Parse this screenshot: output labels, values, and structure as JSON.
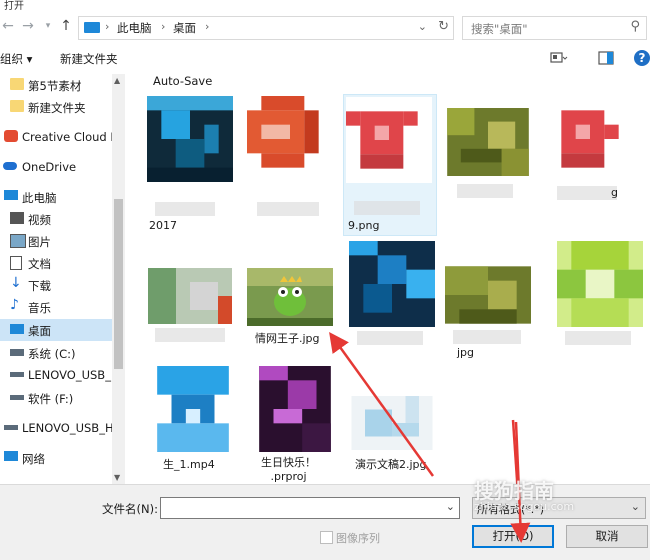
{
  "window": {
    "title": "打开"
  },
  "address": {
    "crumbs": [
      "此电脑",
      "桌面"
    ]
  },
  "search": {
    "placeholder": "搜索\"桌面\""
  },
  "toolbar": {
    "organize": "组织 ▾",
    "new_folder": "新建文件夹",
    "help": "?"
  },
  "sidebar": {
    "items": [
      {
        "label": "第5节素材",
        "icon": "folder-icon"
      },
      {
        "label": "新建文件夹",
        "icon": "folder-icon"
      },
      {
        "label": "Creative Cloud F",
        "icon": "creative-cloud-icon"
      },
      {
        "label": "OneDrive",
        "icon": "cloud-icon"
      },
      {
        "label": "此电脑",
        "icon": "computer-icon"
      },
      {
        "label": "视频",
        "icon": "video-icon"
      },
      {
        "label": "图片",
        "icon": "picture-icon"
      },
      {
        "label": "文档",
        "icon": "document-icon"
      },
      {
        "label": "下载",
        "icon": "download-icon"
      },
      {
        "label": "音乐",
        "icon": "music-icon"
      },
      {
        "label": "桌面",
        "icon": "desktop-icon",
        "selected": true
      },
      {
        "label": "系统 (C:)",
        "icon": "drive-icon"
      },
      {
        "label": "LENOVO_USB_",
        "icon": "drive-icon"
      },
      {
        "label": "软件 (F:)",
        "icon": "drive-icon"
      },
      {
        "label": "LENOVO_USB_H",
        "icon": "drive-icon"
      },
      {
        "label": "网络",
        "icon": "network-icon"
      }
    ]
  },
  "content": {
    "group_header": "Auto-Save",
    "files": [
      {
        "label": "2017"
      },
      {
        "label": ""
      },
      {
        "label": "9.png"
      },
      {
        "label": ""
      },
      {
        "label": "g"
      },
      {
        "label": ""
      },
      {
        "label": "情网王子.jpg"
      },
      {
        "label": ""
      },
      {
        "label": "jpg"
      },
      {
        "label": ""
      },
      {
        "label": "生_1.mp4"
      },
      {
        "label": "生日快乐！\n.prproj"
      },
      {
        "label": "演示文稿2.jpg"
      }
    ]
  },
  "bottom": {
    "filename_label": "文件名(N):",
    "filename_value": "",
    "filetype_value": "所有格式(*.*)",
    "image_sequence_label": "图像序列",
    "open_button": "打开(O)",
    "cancel_button": "取消"
  },
  "watermark": {
    "text": "搜狗指南",
    "sub": "zhinan.sogou.com"
  },
  "colors": {
    "accent": "#0078d7",
    "selected": "#cce4f7",
    "arrow": "#e53935"
  }
}
